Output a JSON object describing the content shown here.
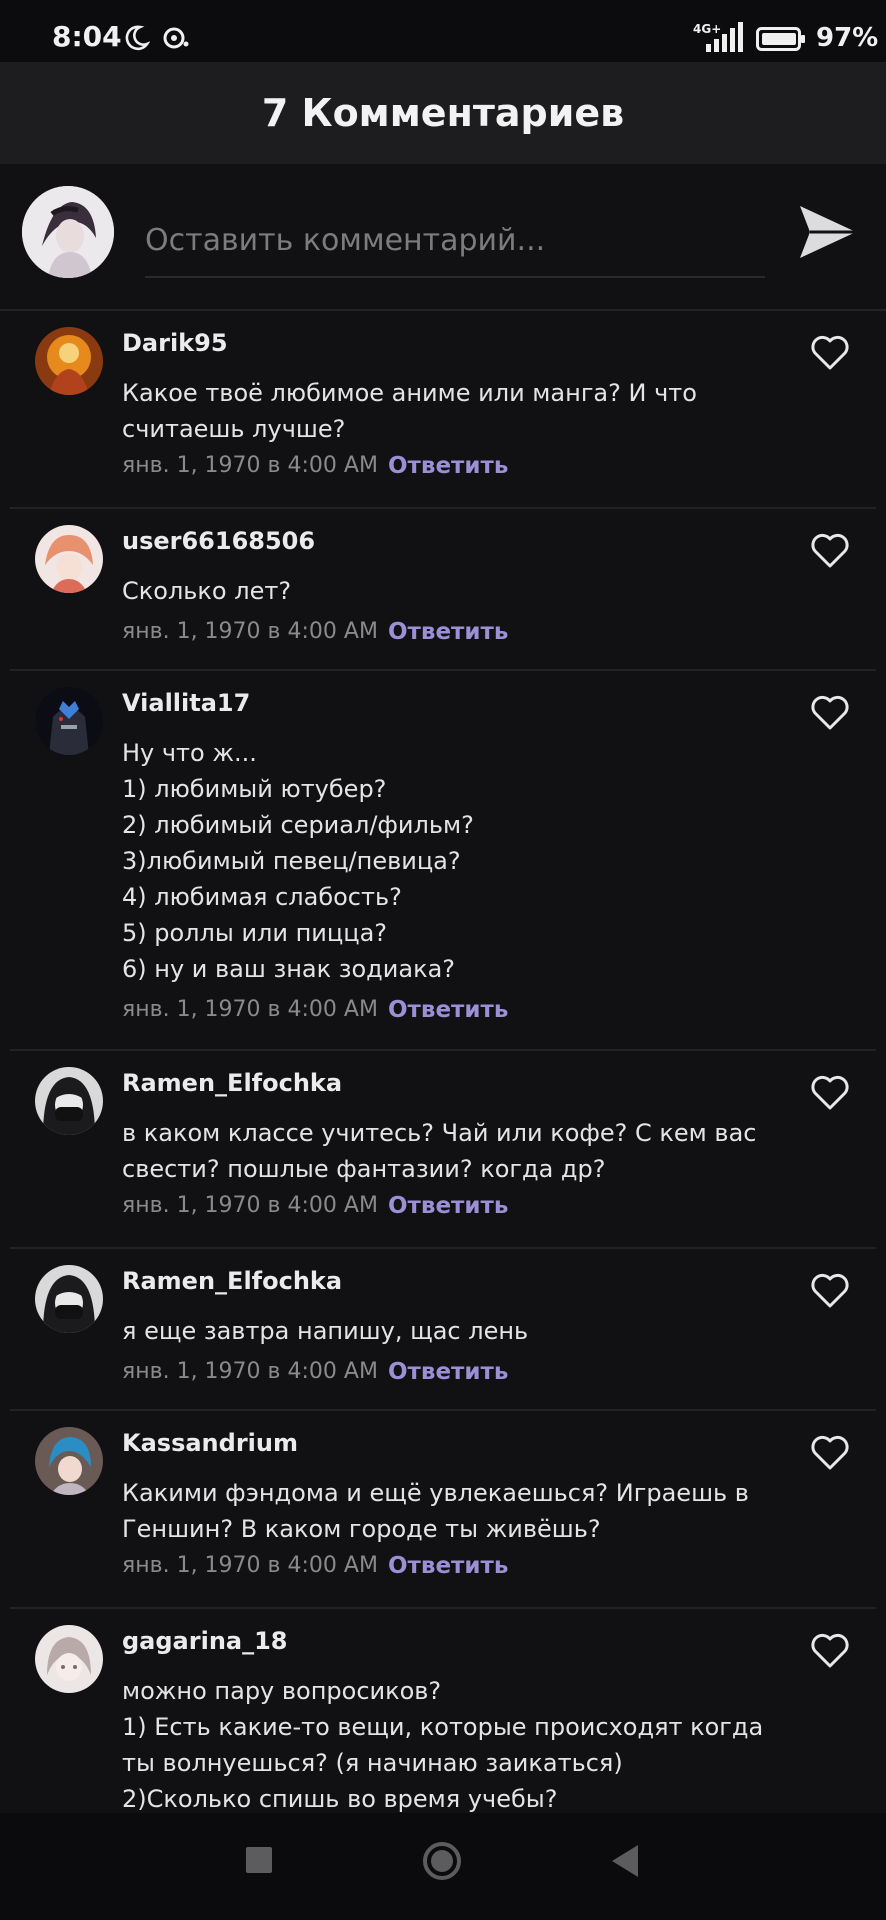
{
  "status_bar": {
    "time": "8:04",
    "network": "4G+",
    "battery": "97%",
    "icons": [
      "moon-icon",
      "notification-icon",
      "signal-icon",
      "battery-icon"
    ]
  },
  "header": {
    "title": "7 Комментариев"
  },
  "compose": {
    "placeholder": "Оставить комментарий...",
    "send_icon": "send-icon"
  },
  "comments": [
    {
      "user": "Darik95",
      "text": "Какое твоё любимое аниме или манга? И что\nсчитаешь лучше?",
      "time": "янв. 1, 1970 в 4:00 AM",
      "reply": "Ответить"
    },
    {
      "user": "user66168506",
      "text": "Сколько лет?",
      "time": "янв. 1, 1970 в 4:00 AM",
      "reply": "Ответить"
    },
    {
      "user": "Viallita17",
      "text": "Ну что ж...\n1) любимый ютубер?\n2) любимый сериал/фильм?\n3)любимый певец/певица?\n4) любимая слабость?\n5) роллы или пицца?\n6) ну и ваш знак зодиака?",
      "time": "янв. 1, 1970 в 4:00 AM",
      "reply": "Ответить"
    },
    {
      "user": "Ramen_Elfochka",
      "text": "в каком классе учитесь? Чай или кофе? С кем вас\nсвести? пошлые фантазии? когда др?",
      "time": "янв. 1, 1970 в 4:00 AM",
      "reply": "Ответить"
    },
    {
      "user": "Ramen_Elfochka",
      "text": "я еще завтра напишу, щас лень",
      "time": "янв. 1, 1970 в 4:00 AM",
      "reply": "Ответить"
    },
    {
      "user": "Kassandrium",
      "text": "Какими фэндома и ещё увлекаешься? Играешь в\nГеншин? В каком городе ты живёшь?",
      "time": "янв. 1, 1970 в 4:00 AM",
      "reply": "Ответить"
    },
    {
      "user": "gagarina_18",
      "text": "можно пару вопросиков?\n1) Есть какие-то вещи, которые происходят когда\nты волнуешься? (я начинаю заикаться)\n2)Сколько спишь во время учебы?",
      "time": "",
      "reply": ""
    }
  ],
  "colors": {
    "background": "#111012",
    "header": "#1d1c1e",
    "reply_accent": "#9b8fd6",
    "meta_text": "#8a898c"
  }
}
